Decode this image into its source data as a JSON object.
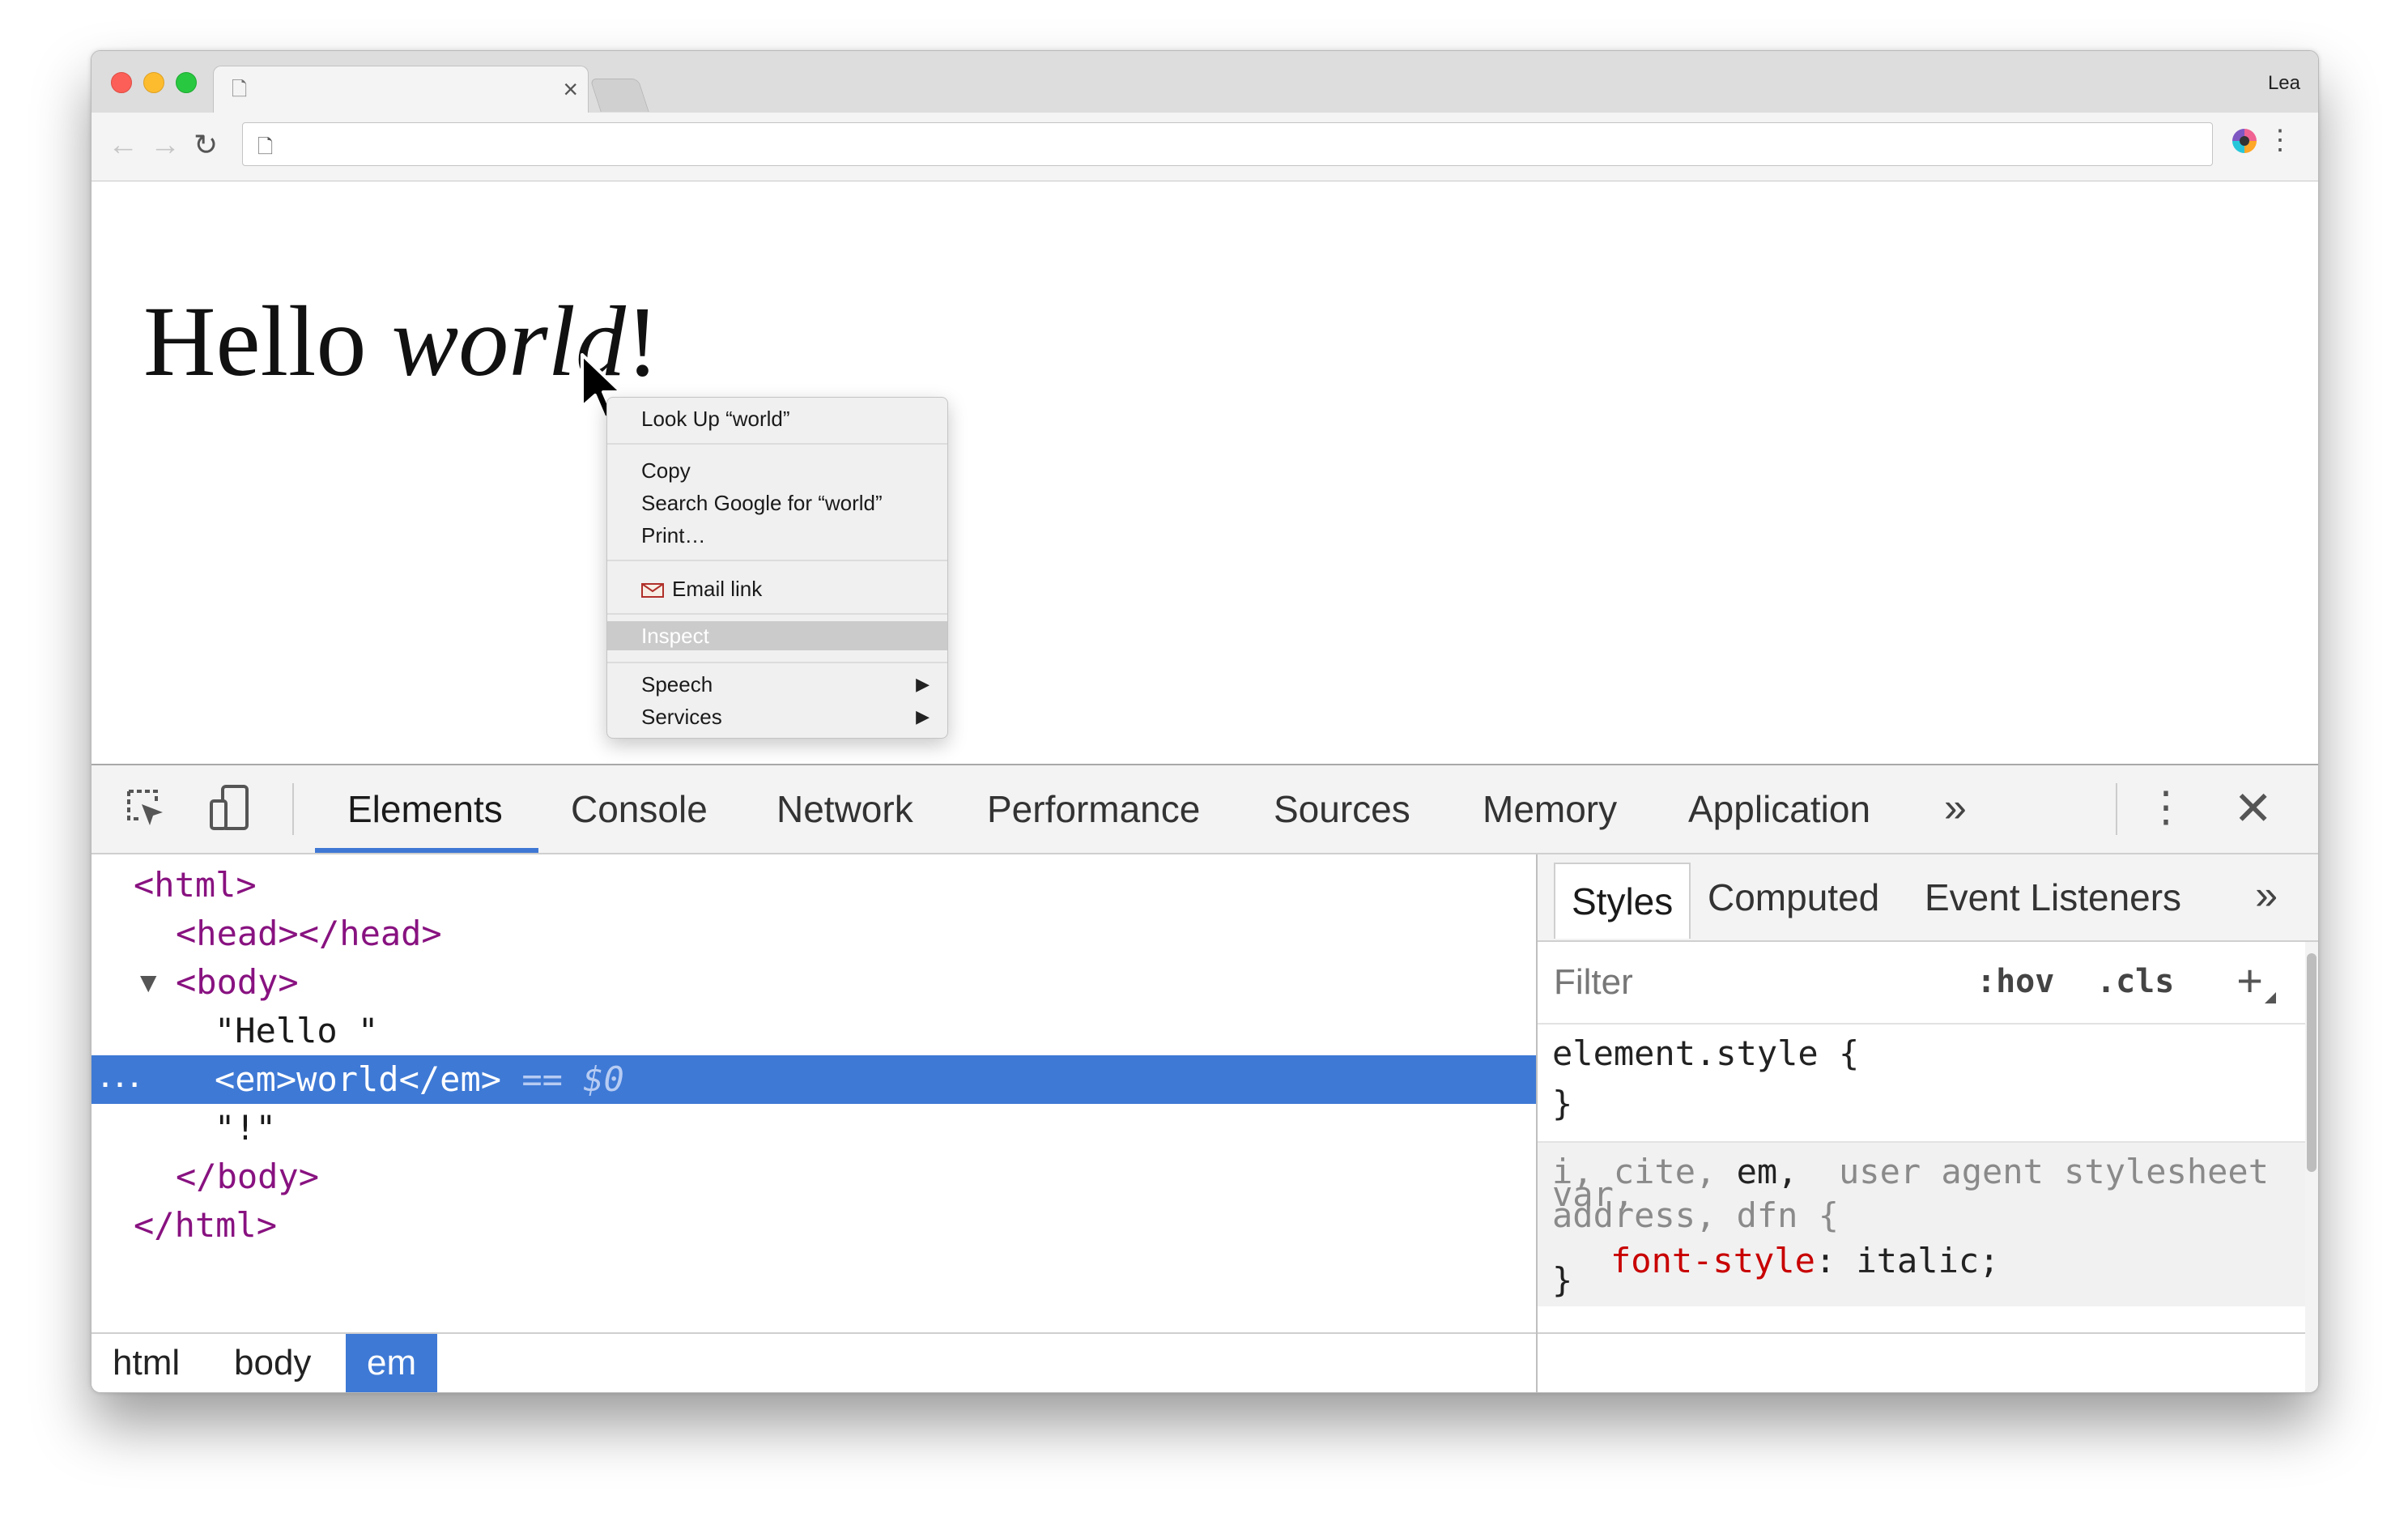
{
  "browser": {
    "profile_name": "Lea",
    "tab": {
      "title": "",
      "close_glyph": "×",
      "icon": "document-icon"
    },
    "nav": {
      "back_glyph": "←",
      "forward_glyph": "→",
      "reload_glyph": "↻",
      "menu_glyph": "⋮"
    },
    "address": {
      "value": "",
      "icon": "document-icon"
    }
  },
  "page": {
    "heading_before": "Hello ",
    "heading_em": "world",
    "heading_after": "!"
  },
  "context_menu": {
    "items": [
      {
        "label": "Look Up “world”"
      },
      {
        "label": "Copy"
      },
      {
        "label": "Search Google for “world”"
      },
      {
        "label": "Print…"
      },
      {
        "label": "Email link",
        "icon": "email-icon"
      },
      {
        "label": "Inspect",
        "highlighted": true
      },
      {
        "label": "Speech",
        "submenu": true
      },
      {
        "label": "Services",
        "submenu": true
      }
    ],
    "submenu_glyph": "▶"
  },
  "devtools": {
    "tabs": [
      "Elements",
      "Console",
      "Network",
      "Performance",
      "Sources",
      "Memory",
      "Application"
    ],
    "active_tab": "Elements",
    "more_glyph": "»",
    "menu_glyph": "⋮",
    "close_glyph": "✕",
    "tree": {
      "html_open": "<html>",
      "head": "<head></head>",
      "body_open": "<body>",
      "text_hello": "\"Hello \"",
      "em_open": "<em>",
      "em_text": "world",
      "em_close": "</em>",
      "eq": "==",
      "dollar": "$0",
      "text_bang": "\"!\"",
      "body_close": "</body>",
      "html_close": "</html>",
      "ellipsis": "...",
      "expand_glyph": "▼"
    },
    "breadcrumbs": [
      "html",
      "body",
      "em"
    ],
    "active_crumb": "em",
    "styles": {
      "tabs": [
        "Styles",
        "Computed",
        "Event Listeners"
      ],
      "active_tab": "Styles",
      "more_glyph": "»",
      "filter_placeholder": "Filter",
      "hov": ":hov",
      "cls": ".cls",
      "add_glyph": "+",
      "element_style": "element.style {",
      "element_style_close": "}",
      "ua_selector_a": "i, cite, ",
      "ua_selector_em": "em,",
      "ua_source": "user agent stylesheet",
      "ua_selector_b": "var,",
      "ua_selector_c": "address, dfn {",
      "ua_prop": "font-style",
      "ua_value": ": italic;",
      "ua_close": "}"
    }
  },
  "colors": {
    "selection": "#3e79d5",
    "tag": "#881280",
    "css_property": "#c80000",
    "traffic_red": "#fc5f57",
    "traffic_yellow": "#fdbc2e",
    "traffic_green": "#28c840"
  }
}
